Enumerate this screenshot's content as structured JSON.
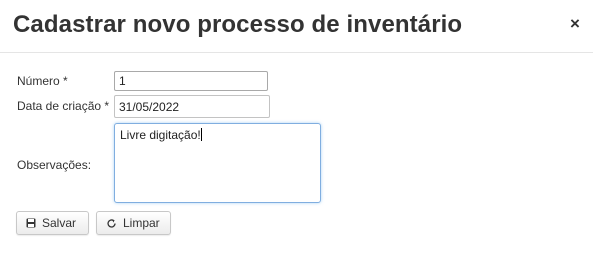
{
  "dialog": {
    "title": "Cadastrar novo processo de inventário",
    "close_symbol": "×"
  },
  "form": {
    "numero": {
      "label": "Número",
      "required_mark": "*",
      "value": "1"
    },
    "data_criacao": {
      "label": "Data de criação",
      "required_mark": "*",
      "value": "31/05/2022"
    },
    "observacoes": {
      "label": "Observações:",
      "value": "Livre digitação!"
    }
  },
  "buttons": {
    "save": {
      "label": "Salvar",
      "icon": "save-icon"
    },
    "clear": {
      "label": "Limpar",
      "icon": "refresh-icon"
    }
  }
}
